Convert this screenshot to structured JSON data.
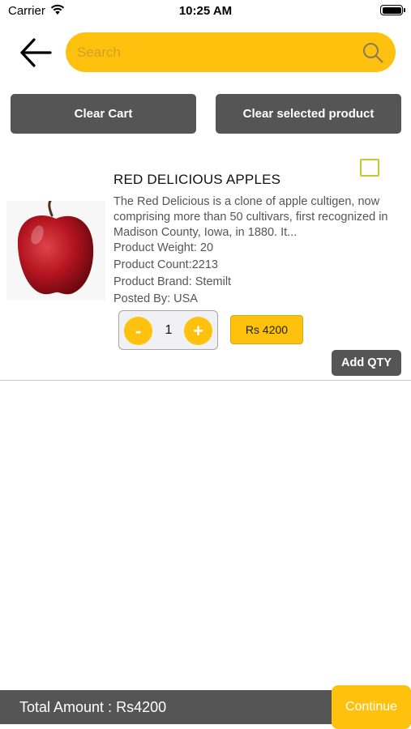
{
  "status_bar": {
    "carrier": "Carrier",
    "time": "10:25 AM",
    "icons": [
      "wifi-icon",
      "battery-icon"
    ]
  },
  "header": {
    "back_icon": "arrow-left-icon",
    "search": {
      "placeholder": "Search",
      "value": "",
      "icon": "search-icon"
    }
  },
  "actions": {
    "clear_cart_label": "Clear Cart",
    "clear_selected_label": "Clear selected product"
  },
  "cart_items": [
    {
      "image": "red-apple-image",
      "name": "RED DELICIOUS APPLES",
      "description": "The Red Delicious is a clone of apple cultigen, now comprising more than 50 cultivars, first recognized in Madison County, Iowa, in 1880. It...",
      "weight": "Product Weight: 20",
      "count": "Product Count:2213",
      "brand": "Product Brand: Stemilt",
      "posted_by": "Posted By: USA",
      "selected": false,
      "stepper": {
        "minus_label": "-",
        "plus_label": "+",
        "quantity": "1"
      },
      "price": "Rs 4200",
      "add_qty_label": "Add QTY"
    }
  ],
  "footer": {
    "total_label": "Total Amount : Rs4200",
    "continue_label": "Continue"
  },
  "colors": {
    "accent": "#fdc10e",
    "dark_button": "#555555",
    "checkbox_border": "#c2c92a",
    "background": "#ffffff"
  }
}
